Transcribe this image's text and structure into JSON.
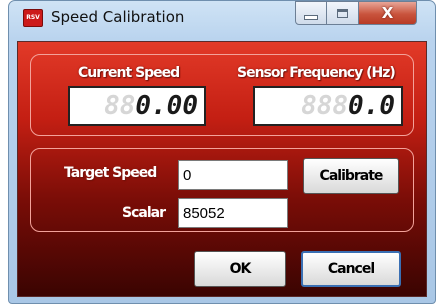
{
  "window": {
    "title": "Speed Calibration",
    "icon_text": "RSV",
    "icon_name": "app-logo-icon",
    "controls": {
      "minimize": "minimize-icon",
      "maximize": "maximize-icon",
      "close": "close-icon",
      "close_glyph": "X"
    }
  },
  "gauges": {
    "speed": {
      "label": "Current Speed",
      "ghost": "88",
      "value": "0.00"
    },
    "frequency": {
      "label": "Sensor Frequency (Hz)",
      "ghost": "888",
      "value": "0.0"
    }
  },
  "form": {
    "target_speed": {
      "label": "Target Speed",
      "value": "0"
    },
    "scalar": {
      "label": "Scalar",
      "value": "85052"
    },
    "calibrate_label": "Calibrate"
  },
  "buttons": {
    "ok": "OK",
    "cancel": "Cancel"
  },
  "colors": {
    "panel_top": "#e23a28",
    "panel_bottom": "#3a0402",
    "frame": "#b9d3ee",
    "close_button": "#c9543d"
  }
}
